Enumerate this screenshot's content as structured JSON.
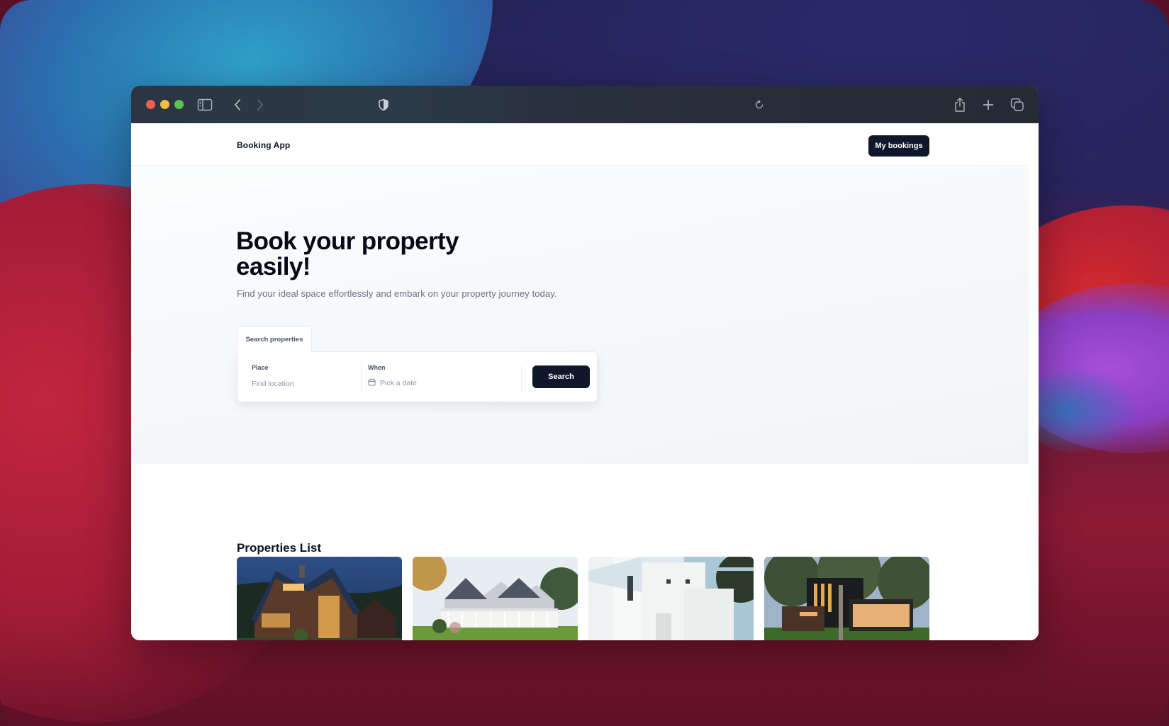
{
  "browser": {
    "toolbar": {
      "icons": [
        "sidebar-icon",
        "back-icon",
        "forward-icon",
        "privacy-shield-icon",
        "reload-icon",
        "share-icon",
        "new-tab-icon",
        "tab-overview-icon"
      ]
    }
  },
  "header": {
    "brand": "Booking App",
    "my_bookings_label": "My bookings"
  },
  "hero": {
    "title_line1": "Book your property",
    "title_line2": "easily!",
    "subtitle": "Find your ideal space effortlessly and embark on your property journey today."
  },
  "search": {
    "tab_label": "Search properties",
    "place": {
      "label": "Place",
      "value": "",
      "placeholder": "Find location"
    },
    "when": {
      "label": "When",
      "placeholder": "Pick a date",
      "icon": "calendar-icon"
    },
    "search_label": "Search"
  },
  "properties": {
    "title": "Properties List",
    "items": [
      {
        "name": "property-card-1",
        "image": "Wooden house at dusk with lit windows"
      },
      {
        "name": "property-card-2",
        "image": "White colonial house with porch and lawn"
      },
      {
        "name": "property-card-3",
        "image": "White modern cubic house"
      },
      {
        "name": "property-card-4",
        "image": "Modern dark house with glass walls under tree"
      }
    ]
  },
  "colors": {
    "primary_button": "#0f172a",
    "heading": "#050a18",
    "muted_text": "#667085",
    "hero_bg": "#f4f6f9",
    "toolbar_bg": "#272f3b",
    "traffic_red": "#ee5e57",
    "traffic_yellow": "#f4bd43",
    "traffic_green": "#5bc44d"
  }
}
